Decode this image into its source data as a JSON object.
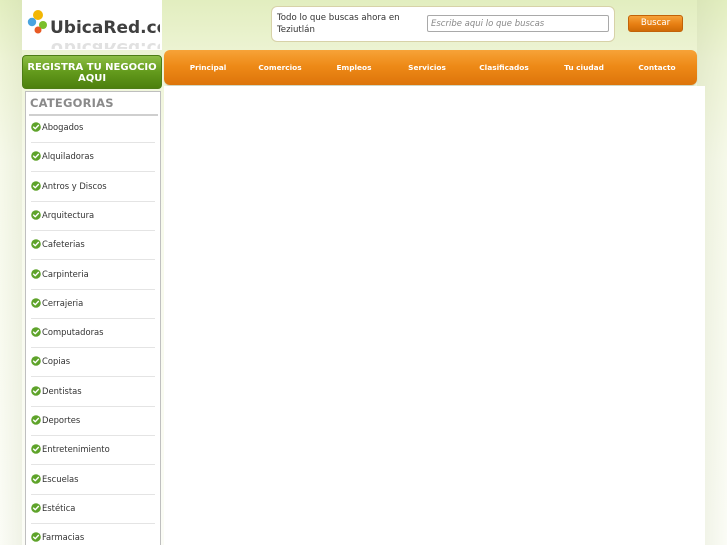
{
  "logo": {
    "text": "UbicaRed.com"
  },
  "search": {
    "prompt": "Todo lo que buscas ahora en Teziutlán",
    "placeholder": "Escribe aqui lo que buscas",
    "button_label": "Buscar"
  },
  "register_button": {
    "label": "REGISTRA TU NEGOCIO AQUI"
  },
  "nav": {
    "items": [
      {
        "label": "Principal"
      },
      {
        "label": "Comercios"
      },
      {
        "label": "Empleos"
      },
      {
        "label": "Servicios"
      },
      {
        "label": "Clasificados"
      },
      {
        "label": "Tu ciudad"
      },
      {
        "label": "Contacto"
      }
    ]
  },
  "sidebar": {
    "title": "CATEGORIAS",
    "items": [
      {
        "label": "Abogados"
      },
      {
        "label": "Alquiladoras"
      },
      {
        "label": "Antros y Discos"
      },
      {
        "label": "Arquitectura"
      },
      {
        "label": "Cafeterias"
      },
      {
        "label": "Carpinteria"
      },
      {
        "label": "Cerrajeria"
      },
      {
        "label": "Computadoras"
      },
      {
        "label": "Copias"
      },
      {
        "label": "Dentistas"
      },
      {
        "label": "Deportes"
      },
      {
        "label": "Entretenimiento"
      },
      {
        "label": "Escuelas"
      },
      {
        "label": "Estética"
      },
      {
        "label": "Farmacias"
      }
    ]
  },
  "colors": {
    "nav_orange": "#ee8a17",
    "register_green": "#639a1c",
    "check_green": "#5ea32a",
    "page_bg": "#eef4d6"
  }
}
